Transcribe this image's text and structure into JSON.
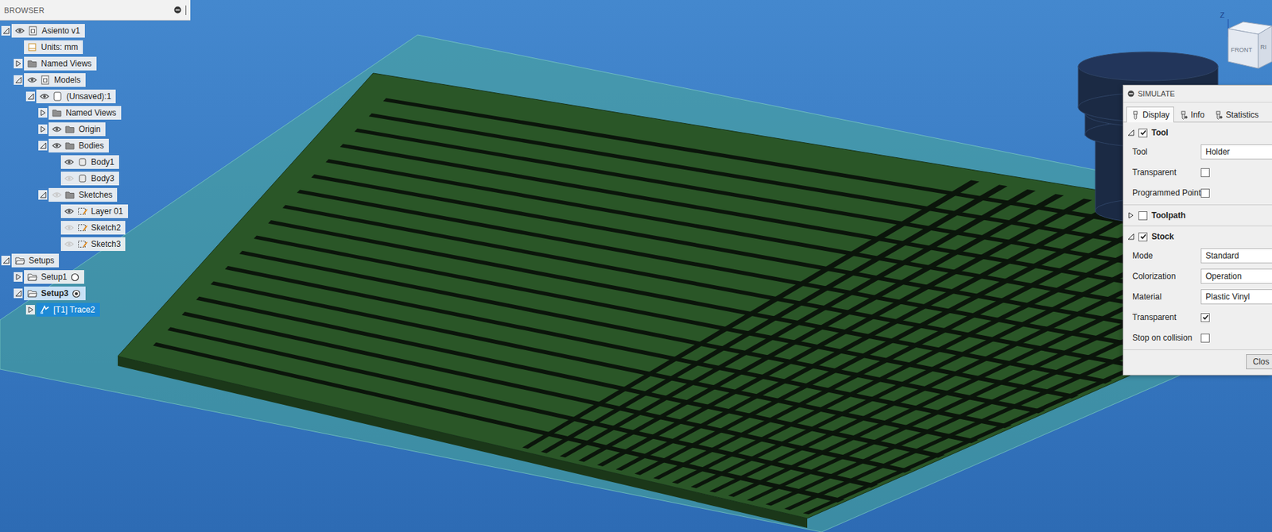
{
  "browser": {
    "title": "BROWSER",
    "roots": [
      {
        "label": "Asiento v1",
        "kind": "component",
        "expanded": true,
        "visible": true,
        "selected": false,
        "children": [
          {
            "label": "Units: mm",
            "kind": "units",
            "selected": false
          },
          {
            "label": "Named Views",
            "kind": "folder",
            "expanded": false,
            "selected": false
          },
          {
            "label": "Models",
            "kind": "component",
            "expanded": true,
            "visible": true,
            "selected": false,
            "children": [
              {
                "label": "(Unsaved):1",
                "kind": "body-group",
                "expanded": true,
                "visible": true,
                "selected": false,
                "children": [
                  {
                    "label": "Named Views",
                    "kind": "folder",
                    "expanded": false,
                    "selected": false
                  },
                  {
                    "label": "Origin",
                    "kind": "folder",
                    "expanded": false,
                    "visible": true,
                    "selected": false
                  },
                  {
                    "label": "Bodies",
                    "kind": "folder",
                    "expanded": true,
                    "visible": true,
                    "selected": false,
                    "children": [
                      {
                        "label": "Body1",
                        "kind": "body",
                        "visible": true,
                        "selected": false
                      },
                      {
                        "label": "Body3",
                        "kind": "body",
                        "visible": false,
                        "selected": false
                      }
                    ]
                  },
                  {
                    "label": "Sketches",
                    "kind": "folder",
                    "expanded": true,
                    "visible": false,
                    "selected": false,
                    "children": [
                      {
                        "label": "Layer 01",
                        "kind": "sketch",
                        "visible": true,
                        "selected": false
                      },
                      {
                        "label": "Sketch2",
                        "kind": "sketch",
                        "visible": false,
                        "selected": false
                      },
                      {
                        "label": "Sketch3",
                        "kind": "sketch",
                        "visible": false,
                        "selected": false
                      }
                    ]
                  }
                ]
              }
            ]
          }
        ]
      },
      {
        "label": "Setups",
        "kind": "setups",
        "expanded": true,
        "selected": false,
        "children": [
          {
            "label": "Setup1",
            "kind": "setup",
            "expanded": false,
            "active": false,
            "selected": false
          },
          {
            "label": "Setup3",
            "kind": "setup",
            "expanded": true,
            "active": true,
            "selected": false,
            "children": [
              {
                "label": "[T1] Trace2",
                "kind": "operation",
                "expanded": false,
                "selected": true
              }
            ]
          }
        ]
      }
    ]
  },
  "simulate": {
    "title": "SIMULATE",
    "tabs": [
      {
        "label": "Display",
        "selected": true
      },
      {
        "label": "Info",
        "selected": false
      },
      {
        "label": "Statistics",
        "selected": false
      }
    ],
    "sections": [
      {
        "label": "Tool",
        "checked": true,
        "expanded": true,
        "rows": [
          {
            "label": "Tool",
            "kind": "select",
            "value": "Holder"
          },
          {
            "label": "Transparent",
            "kind": "checkbox",
            "checked": false
          },
          {
            "label": "Programmed Point",
            "kind": "checkbox",
            "checked": false
          }
        ]
      },
      {
        "label": "Toolpath",
        "checked": false,
        "expanded": false,
        "rows": []
      },
      {
        "label": "Stock",
        "checked": true,
        "expanded": true,
        "rows": [
          {
            "label": "Mode",
            "kind": "select",
            "value": "Standard"
          },
          {
            "label": "Colorization",
            "kind": "select",
            "value": "Operation"
          },
          {
            "label": "Material",
            "kind": "select",
            "value": "Plastic Vinyl"
          },
          {
            "label": "Transparent",
            "kind": "checkbox",
            "checked": true
          },
          {
            "label": "Stop on collision",
            "kind": "checkbox",
            "checked": false
          }
        ]
      }
    ],
    "button": "Clos"
  },
  "view_cube": {
    "axis": "Z",
    "faces": [
      "FRONT",
      "RI"
    ]
  }
}
